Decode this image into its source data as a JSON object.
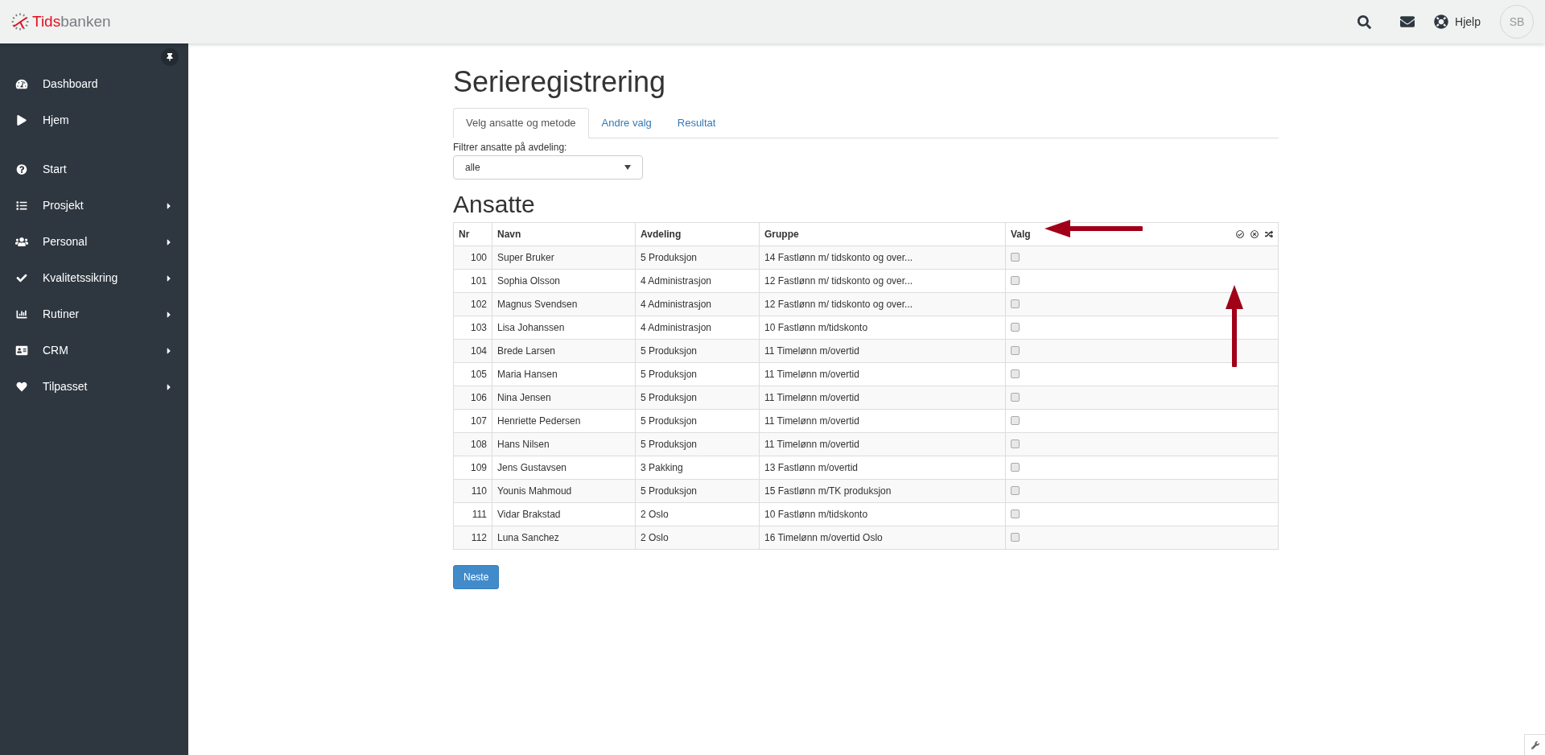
{
  "header": {
    "logo": [
      "Tids",
      "banken"
    ],
    "help": "Hjelp",
    "avatar": "SB"
  },
  "sidebar": {
    "sections": [
      {
        "items": [
          {
            "label": "Dashboard",
            "submenu": false
          },
          {
            "label": "Hjem",
            "submenu": false
          }
        ]
      },
      {
        "items": [
          {
            "label": "Start",
            "submenu": false
          },
          {
            "label": "Prosjekt",
            "submenu": true
          },
          {
            "label": "Personal",
            "submenu": true
          },
          {
            "label": "Kvalitetssikring",
            "submenu": true
          },
          {
            "label": "Rutiner",
            "submenu": true
          },
          {
            "label": "CRM",
            "submenu": true
          },
          {
            "label": "Tilpasset",
            "submenu": true
          }
        ]
      }
    ]
  },
  "page": {
    "title": "Serieregistrering",
    "tabs": [
      {
        "label": "Velg ansatte og metode",
        "selected": true
      },
      {
        "label": "Andre valg",
        "selected": false
      },
      {
        "label": "Resultat",
        "selected": false
      }
    ],
    "filter": {
      "label": "Filtrer ansatte på avdeling:",
      "value": "alle"
    },
    "section_title": "Ansatte",
    "table": {
      "columns": [
        "Nr",
        "Navn",
        "Avdeling",
        "Gruppe",
        "Valg"
      ],
      "rows": [
        {
          "nr": "100",
          "navn": "Super Bruker",
          "avdeling": "5 Produksjon",
          "gruppe": "14 Fastlønn m/ tidskonto og over...",
          "checked": false
        },
        {
          "nr": "101",
          "navn": "Sophia Olsson",
          "avdeling": "4 Administrasjon",
          "gruppe": "12 Fastlønn m/ tidskonto og over...",
          "checked": false
        },
        {
          "nr": "102",
          "navn": "Magnus Svendsen",
          "avdeling": "4 Administrasjon",
          "gruppe": "12 Fastlønn m/ tidskonto og over...",
          "checked": false
        },
        {
          "nr": "103",
          "navn": "Lisa Johanssen",
          "avdeling": "4 Administrasjon",
          "gruppe": "10 Fastlønn m/tidskonto",
          "checked": false
        },
        {
          "nr": "104",
          "navn": "Brede Larsen",
          "avdeling": "5 Produksjon",
          "gruppe": "11 Timelønn m/overtid",
          "checked": false
        },
        {
          "nr": "105",
          "navn": "Maria Hansen",
          "avdeling": "5 Produksjon",
          "gruppe": "11 Timelønn m/overtid",
          "checked": false
        },
        {
          "nr": "106",
          "navn": "Nina Jensen",
          "avdeling": "5 Produksjon",
          "gruppe": "11 Timelønn m/overtid",
          "checked": false
        },
        {
          "nr": "107",
          "navn": "Henriette Pedersen",
          "avdeling": "5 Produksjon",
          "gruppe": "11 Timelønn m/overtid",
          "checked": false
        },
        {
          "nr": "108",
          "navn": "Hans Nilsen",
          "avdeling": "5 Produksjon",
          "gruppe": "11 Timelønn m/overtid",
          "checked": false
        },
        {
          "nr": "109",
          "navn": "Jens Gustavsen",
          "avdeling": "3 Pakking",
          "gruppe": "13 Fastlønn m/overtid",
          "checked": false
        },
        {
          "nr": "110",
          "navn": "Younis Mahmoud",
          "avdeling": "5 Produksjon",
          "gruppe": "15 Fastlønn m/TK produksjon",
          "checked": false
        },
        {
          "nr": "111",
          "navn": "Vidar Brakstad",
          "avdeling": "2 Oslo",
          "gruppe": "10 Fastlønn m/tidskonto",
          "checked": false
        },
        {
          "nr": "112",
          "navn": "Luna Sanchez",
          "avdeling": "2 Oslo",
          "gruppe": "16 Timelønn m/overtid Oslo",
          "checked": false
        }
      ]
    },
    "next_button": "Neste"
  }
}
